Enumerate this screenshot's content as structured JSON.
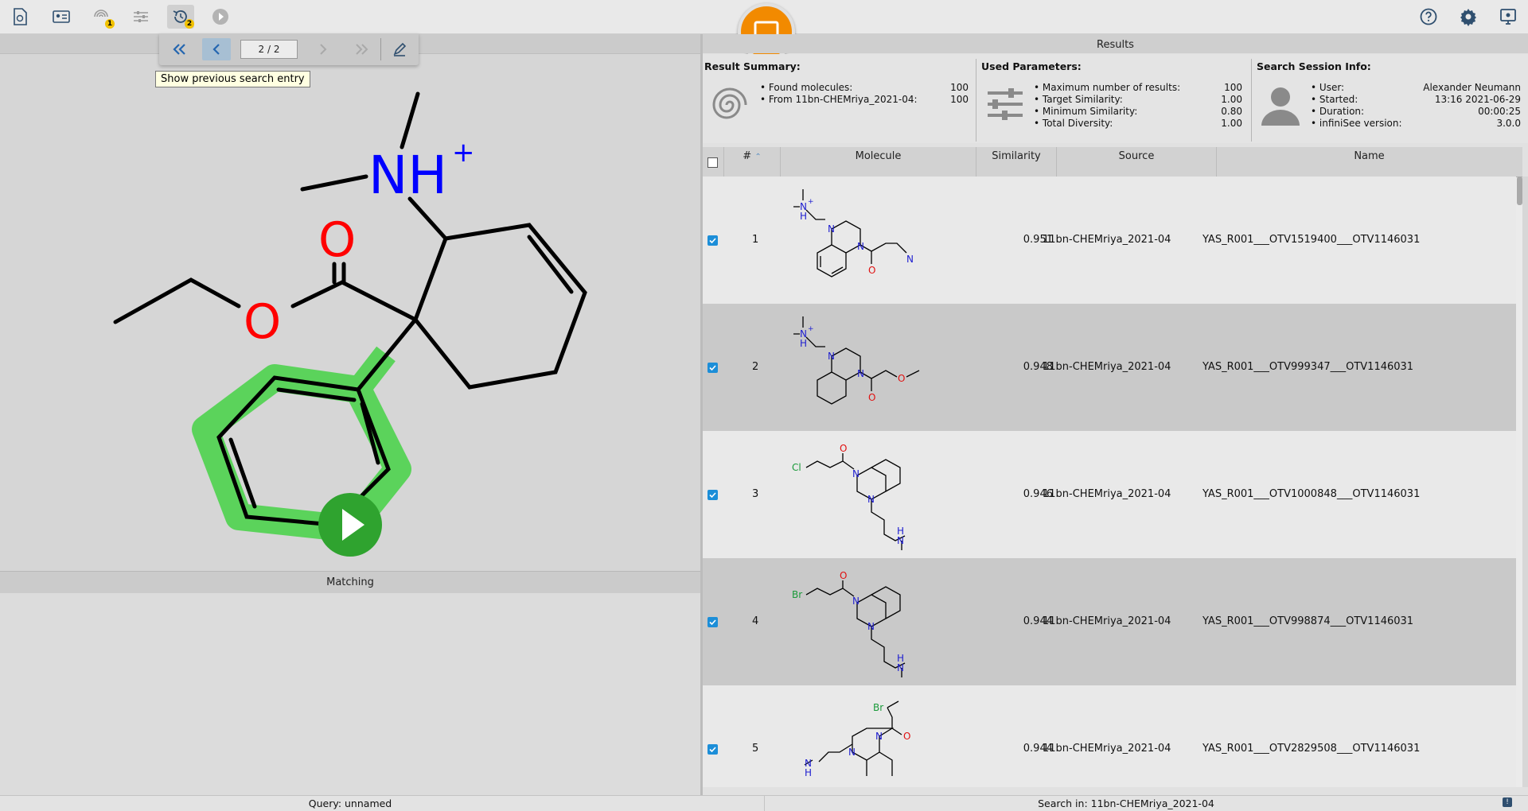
{
  "toolbar": {
    "history_badge": "2",
    "fingerprint_badge": "1"
  },
  "history_nav": {
    "counter": "2 / 2",
    "tooltip": "Show previous search entry"
  },
  "query": {
    "labels": {
      "nh": "NH",
      "plus": "+",
      "o_carbonyl": "O",
      "o_ester": "O"
    }
  },
  "matching": {
    "header": "Matching"
  },
  "results": {
    "header": "Results",
    "summary": {
      "title": "Result Summary:",
      "rows": [
        {
          "label": "Found molecules:",
          "value": "100"
        },
        {
          "label": "From 11bn-CHEMriya_2021-04:",
          "value": "100"
        }
      ]
    },
    "parameters": {
      "title": "Used Parameters:",
      "rows": [
        {
          "label": "Maximum number of results:",
          "value": "100"
        },
        {
          "label": "Target Similarity:",
          "value": "1.00"
        },
        {
          "label": "Minimum Similarity:",
          "value": "0.80"
        },
        {
          "label": "Total Diversity:",
          "value": "1.00"
        }
      ]
    },
    "session": {
      "title": "Search Session Info:",
      "rows": [
        {
          "label": "User:",
          "value": "Alexander Neumann"
        },
        {
          "label": "Started:",
          "value": "13:16 2021-06-29"
        },
        {
          "label": "Duration:",
          "value": "00:00:25"
        },
        {
          "label": "infiniSee version:",
          "value": "3.0.0"
        }
      ]
    },
    "columns": {
      "num": "#",
      "molecule": "Molecule",
      "similarity": "Similarity",
      "source": "Source",
      "name": "Name"
    },
    "rows": [
      {
        "num": "1",
        "similarity": "0.951",
        "source": "11bn-CHEMriya_2021-04",
        "name": "YAS_R001___OTV1519400___OTV1146031"
      },
      {
        "num": "2",
        "similarity": "0.948",
        "source": "11bn-CHEMriya_2021-04",
        "name": "YAS_R001___OTV999347___OTV1146031"
      },
      {
        "num": "3",
        "similarity": "0.946",
        "source": "11bn-CHEMriya_2021-04",
        "name": "YAS_R001___OTV1000848___OTV1146031"
      },
      {
        "num": "4",
        "similarity": "0.944",
        "source": "11bn-CHEMriya_2021-04",
        "name": "YAS_R001___OTV998874___OTV1146031"
      },
      {
        "num": "5",
        "similarity": "0.944",
        "source": "11bn-CHEMriya_2021-04",
        "name": "YAS_R001___OTV2829508___OTV1146031"
      }
    ],
    "mol_labels": {
      "n": "N",
      "o": "O",
      "h": "H",
      "nplus": "N",
      "plus": "+",
      "cl": "Cl",
      "br": "Br"
    }
  },
  "status": {
    "query": "Query: unnamed",
    "search_in": "Search in: 11bn-CHEMriya_2021-04"
  }
}
